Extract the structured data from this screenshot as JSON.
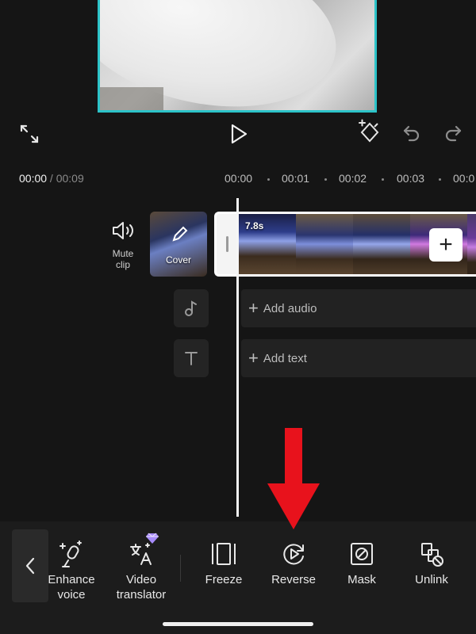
{
  "preview": {
    "controls": {
      "fullscreen_icon": "expand-icon",
      "play_icon": "play-icon",
      "keyframe_icon": "keyframe-add-icon",
      "undo_icon": "undo-icon",
      "redo_icon": "redo-icon"
    }
  },
  "timeline": {
    "current_time": "00:00",
    "separator": " / ",
    "total_time": "00:09",
    "ruler": [
      "00:00",
      "00:01",
      "00:02",
      "00:03",
      "00:0"
    ],
    "mute": {
      "icon": "speaker-icon",
      "label_line1": "Mute",
      "label_line2": "clip"
    },
    "cover": {
      "label": "Cover",
      "icon": "pencil-icon"
    },
    "clip": {
      "duration": "7.8s"
    },
    "add_clip_icon": "plus-icon",
    "audio_track": {
      "icon": "music-note-icon",
      "label": "Add audio"
    },
    "text_track": {
      "icon": "text-t-icon",
      "label": "Add text"
    }
  },
  "toolbar": {
    "back_icon": "chevron-left-icon",
    "items": [
      {
        "id": "enhance-voice",
        "line1": "Enhance",
        "line2": "voice",
        "icon": "enhance-voice-icon"
      },
      {
        "id": "video-translator",
        "line1": "Video",
        "line2": "translator",
        "icon": "translate-icon",
        "badge": "premium-gem-icon"
      },
      {
        "id": "freeze",
        "line1": "Freeze",
        "line2": "",
        "icon": "freeze-frame-icon"
      },
      {
        "id": "reverse",
        "line1": "Reverse",
        "line2": "",
        "icon": "reverse-play-icon"
      },
      {
        "id": "mask",
        "line1": "Mask",
        "line2": "",
        "icon": "mask-icon"
      },
      {
        "id": "unlink",
        "line1": "Unlink",
        "line2": "",
        "icon": "unlink-icon"
      }
    ]
  },
  "colors": {
    "background": "#151515",
    "preview_border": "#2cc3c8",
    "annotation_arrow": "#e8121c",
    "badge": "#a78bfa"
  }
}
